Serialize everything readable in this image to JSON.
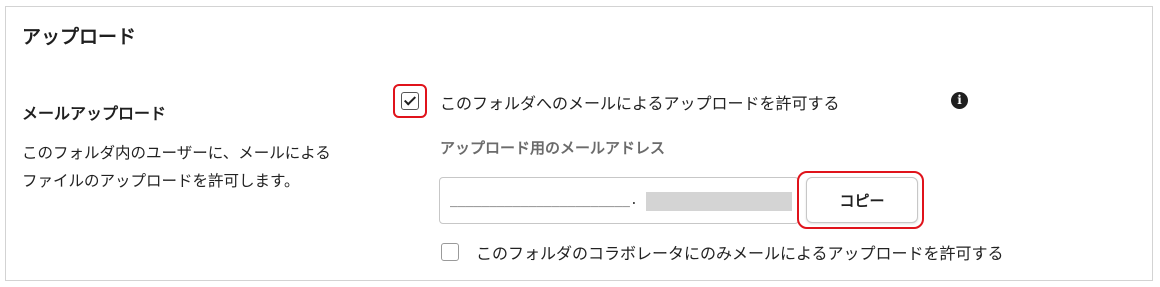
{
  "section": {
    "title": "アップロード"
  },
  "email_upload": {
    "title": "メールアップロード",
    "description": "このフォルダ内のユーザーに、メールによるファイルのアップロードを許可します。",
    "allow_option": {
      "label": "このフォルダへのメールによるアップロードを許可する",
      "checked": true,
      "info_icon": "info-circle-icon"
    },
    "address_label": "アップロード用のメールアドレス",
    "address_value": "_______________________.",
    "copy_button_label": "コピー",
    "collaborators_only_option": {
      "label": "このフォルダのコラボレータにのみメールによるアップロードを許可する",
      "checked": false
    }
  },
  "colors": {
    "highlight": "#e0131b",
    "border": "#d3d3d3",
    "muted_label": "#6b6b6b"
  }
}
